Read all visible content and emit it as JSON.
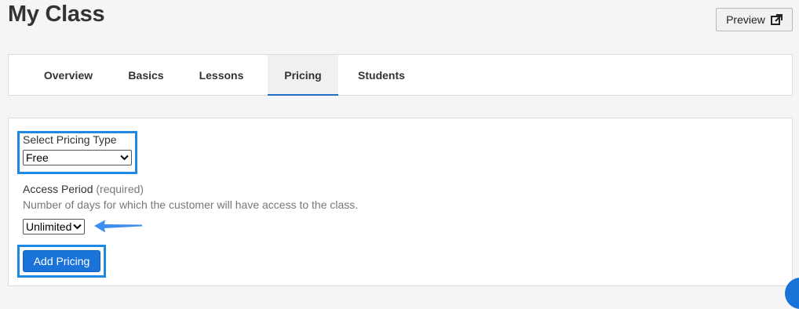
{
  "page": {
    "title": "My Class"
  },
  "header": {
    "preview_label": "Preview",
    "preview_icon": "external-link-icon"
  },
  "tabs": [
    {
      "label": "Overview",
      "active": false
    },
    {
      "label": "Basics",
      "active": false
    },
    {
      "label": "Lessons",
      "active": false
    },
    {
      "label": "Pricing",
      "active": true
    },
    {
      "label": "Students",
      "active": false
    }
  ],
  "pricing_form": {
    "pricing_type": {
      "label": "Select Pricing Type",
      "selected": "Free"
    },
    "access_period": {
      "label": "Access Period",
      "required_note": "(required)",
      "help_text": "Number of days for which the customer will have access to the class.",
      "selected": "Unlimited"
    },
    "add_button_label": "Add Pricing"
  },
  "colors": {
    "accent": "#1a73d9",
    "highlight": "#1e88e5",
    "arrow": "#3d8ef0"
  }
}
